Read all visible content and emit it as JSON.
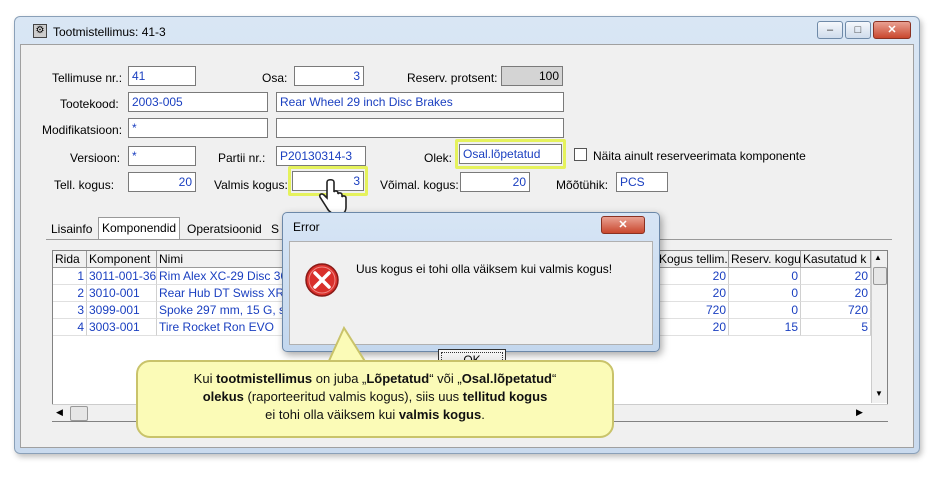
{
  "window": {
    "title": "Tootmistellimus: 41-3",
    "btn_min": "‒",
    "btn_max": "□",
    "btn_close": "✕"
  },
  "form": {
    "order_no_label": "Tellimuse nr.:",
    "order_no": "41",
    "part_label": "Osa:",
    "part": "3",
    "reserve_pct_label": "Reserv. protsent:",
    "reserve_pct": "100",
    "product_code_label": "Tootekood:",
    "product_code": "2003-005",
    "product_name": "Rear Wheel 29 inch Disc Brakes",
    "modification_label": "Modifikatsioon:",
    "modification": "*",
    "modification_desc": "",
    "version_label": "Versioon:",
    "version": "*",
    "batch_label": "Partii nr.:",
    "batch": "P20130314-3",
    "state_label": "Olek:",
    "state": "Osal.lõpetatud",
    "show_unreserved_label": "Näita ainult reserveerimata komponente",
    "ordered_qty_label": "Tell. kogus:",
    "ordered_qty": "20",
    "finished_qty_label": "Valmis kogus:",
    "finished_qty": "3",
    "possible_qty_label": "Võimal. kogus:",
    "possible_qty": "20",
    "unit_label": "Mõõtühik:",
    "unit": "PCS"
  },
  "tabs": [
    {
      "label": "Lisainfo"
    },
    {
      "label": "Komponendid"
    },
    {
      "label": "Operatsioonid"
    },
    {
      "label": "S"
    }
  ],
  "grid": {
    "headers": [
      "Rida",
      "Komponent",
      "Nimi",
      "Kogus tellim.",
      "Reserv. kogu",
      "Kasutatud k"
    ],
    "rows": [
      [
        "1",
        "3011-001-36I",
        "Rim Alex XC-29 Disc 36",
        "20",
        "0",
        "20"
      ],
      [
        "2",
        "3010-001",
        "Rear Hub DT Swiss XR",
        "20",
        "0",
        "20"
      ],
      [
        "3",
        "3099-001",
        "Spoke 297 mm, 15 G, s",
        "720",
        "0",
        "720"
      ],
      [
        "4",
        "3003-001",
        "Tire Rocket Ron EVO",
        "20",
        "15",
        "5"
      ]
    ]
  },
  "dialog": {
    "title": "Error",
    "message": "Uus kogus ei tohi olla väiksem kui valmis kogus!",
    "ok_label": "OK",
    "close_label": "✕"
  },
  "callout": {
    "t1": "Kui ",
    "b1": "tootmistellimus",
    "t2": " on juba „",
    "b2": "Lõpetatud",
    "t3": "“ või „",
    "b3": "Osal.lõpetatud",
    "t4": "“",
    "b4": "olekus",
    "t5": " (raporteeritud valmis kogus), siis uus ",
    "b5": "tellitud kogus",
    "t6": "ei tohi olla väiksem kui ",
    "b6": "valmis kogus",
    "t7": "."
  },
  "colors": {
    "field_text": "#1a3fc0",
    "highlight": "#e5f25c",
    "callout_bg": "#fbfbb7"
  }
}
